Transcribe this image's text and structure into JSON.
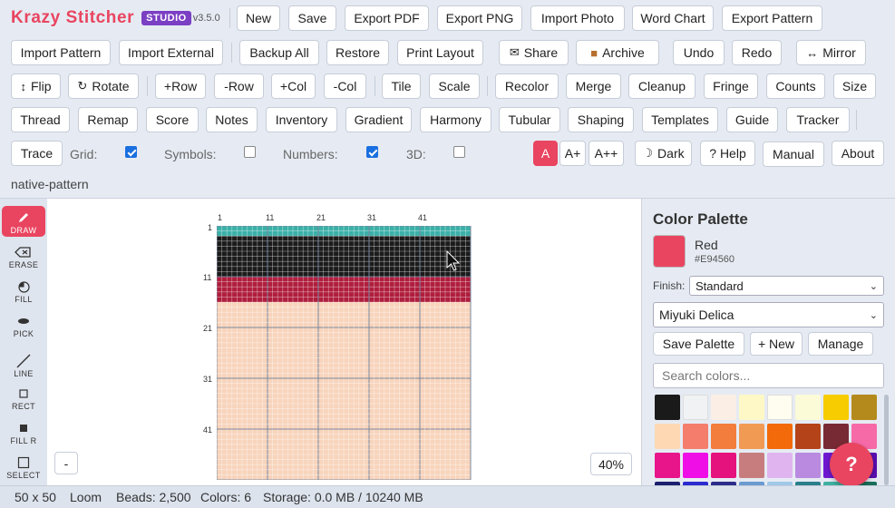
{
  "app": {
    "name": "Krazy Stitcher",
    "edition": "STUDIO",
    "version": "v3.5.0"
  },
  "toolbar": {
    "row1": [
      "New",
      "Save",
      "Export PDF",
      "Export PNG",
      "Import Photo",
      "Word Chart",
      "Export Pattern"
    ],
    "row2": [
      "Import Pattern",
      "Import External",
      "Backup All",
      "Restore",
      "Print Layout",
      "Share",
      "Archive",
      "Undo",
      "Redo",
      "Mirror"
    ],
    "row3": [
      "Flip",
      "Rotate",
      "+Row",
      "-Row",
      "+Col",
      "-Col",
      "Tile",
      "Scale",
      "Recolor",
      "Merge",
      "Cleanup",
      "Fringe",
      "Counts",
      "Size"
    ],
    "row4": [
      "Thread",
      "Remap",
      "Score",
      "Notes",
      "Inventory",
      "Gradient",
      "Harmony",
      "Tubular",
      "Shaping",
      "Templates",
      "Guide",
      "Tracker"
    ],
    "row5": {
      "trace": "Trace",
      "options": [
        {
          "label": "Grid:",
          "checked": true
        },
        {
          "label": "Symbols:",
          "checked": false
        },
        {
          "label": "Numbers:",
          "checked": true
        },
        {
          "label": "3D:",
          "checked": false
        }
      ],
      "font_sizes": [
        "A",
        "A+",
        "A++"
      ],
      "dark": "Dark",
      "help": "? Help",
      "manual": "Manual",
      "about": "About"
    }
  },
  "icons": {
    "share": "envelope-icon",
    "archive": "box-icon",
    "mirror": "left-right-arrow-icon",
    "flip": "up-down-arrow-icon",
    "rotate": "rotate-icon",
    "dark": "moon-icon"
  },
  "file_name": "native-pattern",
  "tools": [
    {
      "label": "DRAW",
      "icon": "pencil-icon",
      "active": true
    },
    {
      "label": "ERASE",
      "icon": "eraser-icon",
      "active": false
    },
    {
      "label": "FILL",
      "icon": "fill-icon",
      "active": false
    },
    {
      "label": "PICK",
      "icon": "eyedropper-icon",
      "active": false
    },
    {
      "label": "LINE",
      "icon": "line-icon",
      "active": false
    },
    {
      "label": "RECT",
      "icon": "rect-icon",
      "active": false
    },
    {
      "label": "FILL R",
      "icon": "filled-rect-icon",
      "active": false
    },
    {
      "label": "SELECT",
      "icon": "select-icon",
      "active": false
    }
  ],
  "canvas": {
    "col_ticks": [
      "1",
      "11",
      "21",
      "31",
      "41"
    ],
    "row_ticks": [
      "1",
      "11",
      "21",
      "31",
      "41"
    ],
    "zoom_out": "-",
    "zoom": "40%"
  },
  "pattern_rows": [
    {
      "rows": 2,
      "color": "#3bb0a8"
    },
    {
      "rows": 8,
      "color": "#1b1b1b"
    },
    {
      "rows": 5,
      "color": "#b01e3d"
    },
    {
      "rows": 35,
      "color": "#f8d4bc"
    }
  ],
  "palette": {
    "title": "Color Palette",
    "current_name": "Red",
    "current_hex": "#E94560",
    "finish_label": "Finish:",
    "finish_value": "Standard",
    "brand_value": "Miyuki Delica",
    "save_palette": "Save Palette",
    "new": "+ New",
    "manage": "Manage",
    "search_placeholder": "Search colors...",
    "swatches": [
      "#1a1a1a",
      "#f1f2f4",
      "#fbeee4",
      "#fdf8c5",
      "#fefdf0",
      "#fbfbd8",
      "#f7cc00",
      "#b48a1c",
      "#fdd8b3",
      "#f47d6c",
      "#f27d3c",
      "#f19a54",
      "#f36a0b",
      "#b4431a",
      "#782a34",
      "#f76aa8",
      "#e8158a",
      "#ef0fe6",
      "#e5117d",
      "#c77d7e",
      "#e0b5ef",
      "#b98ae0",
      "#6f18d1",
      "#5a0fb0",
      "#1b1f6e",
      "#2b2bd0",
      "#2c2c8a",
      "#6a9ad0",
      "#a0c8e8",
      "#2a7f8a",
      "#3fb0a0",
      "#1a6f5a"
    ]
  },
  "help_fab": "?",
  "status": {
    "dims": "50 x 50",
    "mode": "Loom",
    "beads": "Beads: 2,500",
    "colors": "Colors: 6",
    "storage": "Storage: 0.0 MB / 10240 MB"
  }
}
